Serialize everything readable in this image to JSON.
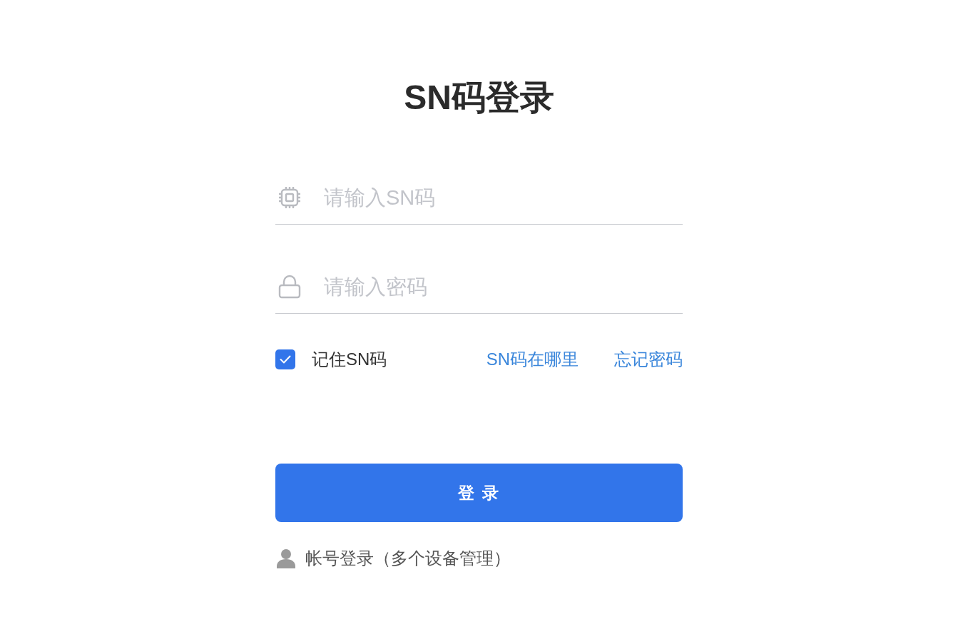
{
  "title": "SN码登录",
  "fields": [
    {
      "kind": "chip",
      "placeholder": "请输入SN码"
    },
    {
      "kind": "lock",
      "placeholder": "请输入密码"
    }
  ],
  "remember": {
    "label": "记住SN码",
    "checked": true
  },
  "links": [
    "SN码在哪里",
    "忘记密码"
  ],
  "login_button": "登 录",
  "account_login": "帐号登录（多个设备管理）"
}
